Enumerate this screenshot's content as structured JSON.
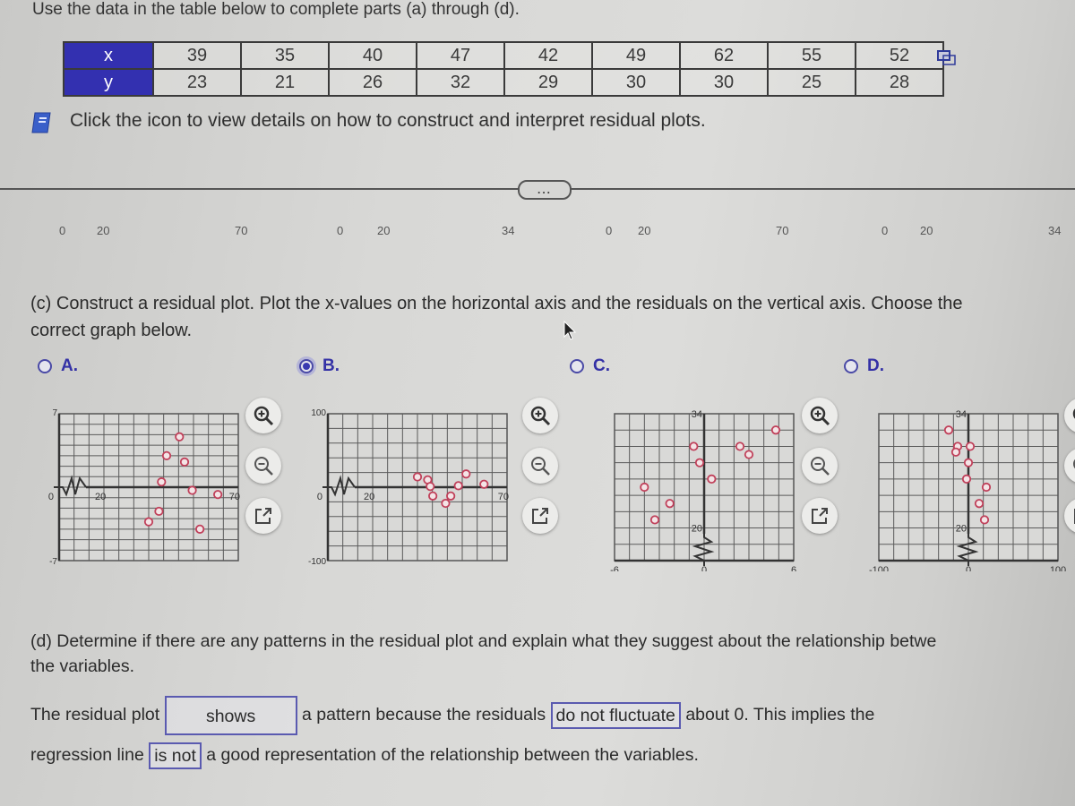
{
  "intro": "Use the data in the table below to complete parts (a) through (d).",
  "table": {
    "x_label": "x",
    "y_label": "y",
    "x": [
      "39",
      "35",
      "40",
      "47",
      "42",
      "49",
      "62",
      "55",
      "52"
    ],
    "y": [
      "23",
      "21",
      "26",
      "32",
      "29",
      "30",
      "30",
      "25",
      "28"
    ]
  },
  "icons": {
    "copy": "copy-icon",
    "book": "book-icon",
    "zoom_in": "zoom-in-icon",
    "zoom_out": "zoom-out-icon",
    "popout": "popout-icon"
  },
  "hint": "Click the icon to view details on how to construct and interpret residual plots.",
  "more_button": "...",
  "ghost_labels": [
    "0",
    "20",
    "70",
    "0",
    "20",
    "34",
    "0",
    "20",
    "70",
    "0",
    "20",
    "34"
  ],
  "part_c": {
    "question": "(c) Construct a residual plot. Plot the x-values on the horizontal axis and the residuals on the vertical axis. Choose the",
    "question_cont": "correct graph below.",
    "selected": "B",
    "options": [
      {
        "id": "A",
        "label": "A."
      },
      {
        "id": "B",
        "label": "B."
      },
      {
        "id": "C",
        "label": "C."
      },
      {
        "id": "D",
        "label": "D."
      }
    ]
  },
  "chart_data": [
    {
      "type": "scatter",
      "option": "A",
      "x_tick_labels": [
        "0",
        "20",
        "70"
      ],
      "y_tick_labels": [
        "7",
        "-7"
      ],
      "xlim": [
        0,
        70
      ],
      "ylim": [
        -7,
        7
      ],
      "axis_break": "x",
      "grid": true,
      "points": [
        [
          35,
          -3.3
        ],
        [
          39,
          -2.3
        ],
        [
          40,
          0.5
        ],
        [
          42,
          3.0
        ],
        [
          47,
          4.8
        ],
        [
          49,
          2.4
        ],
        [
          52,
          -0.3
        ],
        [
          55,
          -4.0
        ],
        [
          62,
          -0.7
        ]
      ]
    },
    {
      "type": "scatter",
      "option": "B",
      "x_tick_labels": [
        "0",
        "20",
        "70"
      ],
      "y_tick_labels": [
        "100",
        "-100"
      ],
      "xlim": [
        0,
        70
      ],
      "ylim": [
        -100,
        100
      ],
      "axis_break": "x",
      "grid": true,
      "points": [
        [
          35,
          14
        ],
        [
          39,
          10
        ],
        [
          40,
          1
        ],
        [
          41,
          -12
        ],
        [
          46,
          -22
        ],
        [
          48,
          -12
        ],
        [
          51,
          2
        ],
        [
          54,
          18
        ],
        [
          61,
          4
        ]
      ]
    },
    {
      "type": "scatter",
      "option": "C",
      "x_tick_labels": [
        "-6",
        "0",
        "6"
      ],
      "y_tick_labels": [
        "34",
        "20"
      ],
      "xlim": [
        -6,
        6
      ],
      "ylim": [
        16,
        34
      ],
      "axis_break": "y",
      "grid": true,
      "points": [
        [
          -4.0,
          25
        ],
        [
          -3.3,
          21
        ],
        [
          -2.3,
          23
        ],
        [
          -0.7,
          30
        ],
        [
          -0.3,
          28
        ],
        [
          0.5,
          26
        ],
        [
          2.4,
          30
        ],
        [
          3.0,
          29
        ],
        [
          4.8,
          32
        ]
      ]
    },
    {
      "type": "scatter",
      "option": "D",
      "x_tick_labels": [
        "-100",
        "0",
        "100"
      ],
      "y_tick_labels": [
        "34",
        "20"
      ],
      "xlim": [
        -100,
        100
      ],
      "ylim": [
        16,
        34
      ],
      "axis_break": "y",
      "grid": true,
      "points": [
        [
          -22,
          32
        ],
        [
          -12,
          30
        ],
        [
          -14,
          29.3
        ],
        [
          2,
          30
        ],
        [
          0,
          28
        ],
        [
          -2,
          26
        ],
        [
          20,
          25
        ],
        [
          12,
          23
        ],
        [
          18,
          21
        ]
      ]
    }
  ],
  "part_d": {
    "question": "(d) Determine if there are any patterns in the residual plot and explain what they suggest about the relationship betwe",
    "question_cont": "the variables.",
    "answer": {
      "t1": "The residual plot",
      "dd1": "shows",
      "t2": "a pattern because the residuals",
      "dd2": "do not fluctuate",
      "t3": "about 0. This implies the",
      "t4": "regression line",
      "dd3": "is not",
      "t5": "a good representation of the relationship between the variables."
    }
  },
  "colors": {
    "header_blue": "#3330b0",
    "accent": "#3431a6",
    "point": "#c0405a"
  }
}
